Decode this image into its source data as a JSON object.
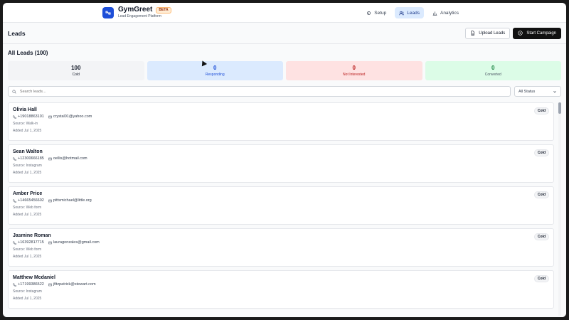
{
  "app": {
    "name": "GymGreet",
    "badge": "BETA",
    "subtitle": "Lead Engagement Platform"
  },
  "nav": [
    {
      "label": "Setup",
      "icon": "gear-icon",
      "active": false
    },
    {
      "label": "Leads",
      "icon": "users-icon",
      "active": true
    },
    {
      "label": "Analytics",
      "icon": "bar-chart-icon",
      "active": false
    }
  ],
  "page": {
    "title": "Leads",
    "upload_label": "Upload Leads",
    "start_label": "Start Campaign"
  },
  "section": {
    "title": "All Leads (100)"
  },
  "stats": [
    {
      "value": "100",
      "label": "Cold"
    },
    {
      "value": "0",
      "label": "Responding"
    },
    {
      "value": "0",
      "label": "Not Interested"
    },
    {
      "value": "0",
      "label": "Converted"
    }
  ],
  "search": {
    "placeholder": "Search leads..."
  },
  "filter": {
    "selected": "All Status"
  },
  "leads": [
    {
      "name": "Olivia Hall",
      "phone": "+19018863101",
      "email": "crystal01@yahoo.com",
      "source": "Source: Walk-in",
      "added": "Added Jul 1, 2025",
      "status": "Cold"
    },
    {
      "name": "Sean Walton",
      "phone": "+12300666185",
      "email": "oellis@hotmail.com",
      "source": "Source: Instagram",
      "added": "Added Jul 1, 2025",
      "status": "Cold"
    },
    {
      "name": "Amber Price",
      "phone": "+14665456602",
      "email": "pittsmichael@little.org",
      "source": "Source: Web form",
      "added": "Added Jul 1, 2025",
      "status": "Cold"
    },
    {
      "name": "Jasmine Roman",
      "phone": "+16392817715",
      "email": "lauragonzales@gmail.com",
      "source": "Source: Web form",
      "added": "Added Jul 1, 2025",
      "status": "Cold"
    },
    {
      "name": "Matthew Mcdaniel",
      "phone": "+17199386522",
      "email": "jfitzpatrick@stewart.com",
      "source": "Source: Instagram",
      "added": "Added Jul 1, 2025",
      "status": "Cold"
    }
  ]
}
